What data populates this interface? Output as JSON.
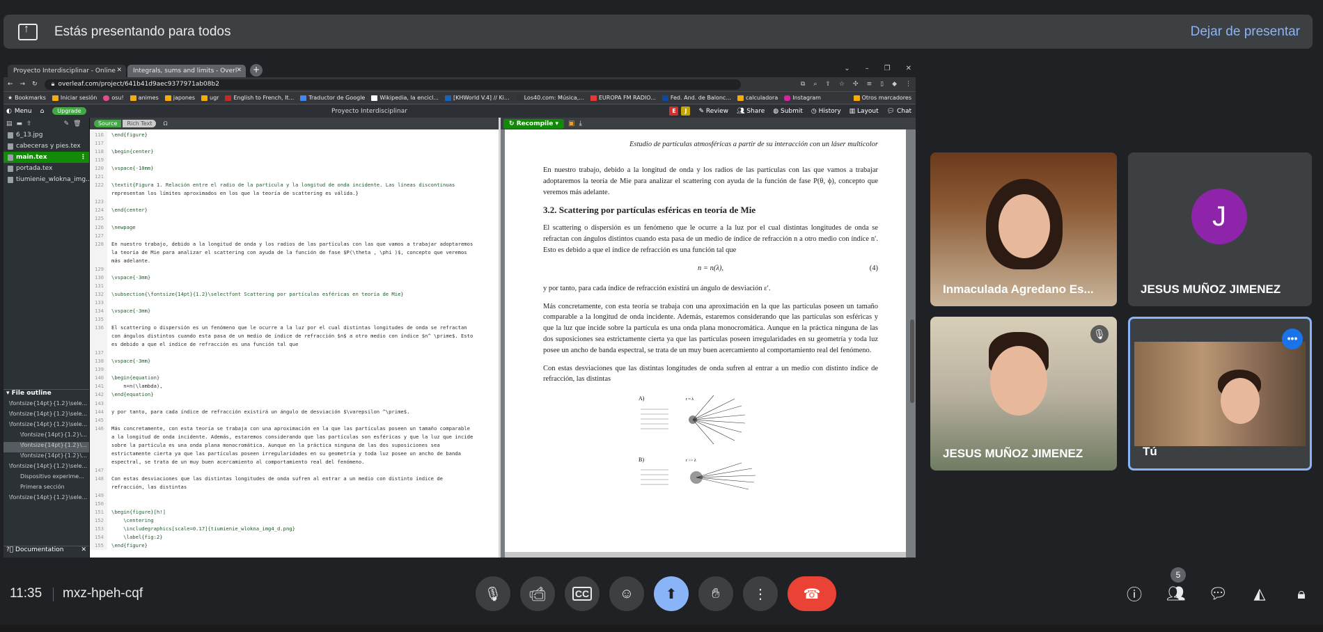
{
  "banner": {
    "title": "Estás presentando para todos",
    "stop_label": "Dejar de presentar"
  },
  "browser": {
    "tabs": [
      {
        "label": "Proyecto Interdisciplinar - Online"
      },
      {
        "label": "Integrals, sums and limits - Overl"
      }
    ],
    "url": "overleaf.com/project/641b41d9aec9377971ab08b2",
    "bookmarks": [
      "Bookmarks",
      "Iniciar sesión",
      "osu!",
      "animes",
      "japones",
      "ugr",
      "English to French, It...",
      "Traductor de Google",
      "Wikipedia, la encicl...",
      "[KHWorld V.4] // Ki...",
      "Los40.com: Música,...",
      "EUROPA FM RADIO...",
      "Fed. And. de Balonc...",
      "calculadora",
      "Instagram",
      "Otros marcadores"
    ]
  },
  "overleaf": {
    "menu_label": "Menu",
    "upgrade_label": "Upgrade",
    "project_title": "Proyecto Interdisciplinar",
    "collab_e": "E",
    "collab_j": "J",
    "toolbar": [
      "Review",
      "Share",
      "Submit",
      "History",
      "Layout",
      "Chat"
    ],
    "source_label": "Source",
    "richtext_label": "Rich Text",
    "recompile_label": "Recompile",
    "files": [
      "6_13.jpg",
      "cabeceras y pies.tex",
      "main.tex",
      "portada.tex",
      "tiumienie_wlokna_img..."
    ],
    "outline_title": "File outline",
    "outline": [
      "\\fontsize{14pt}{1.2}\\sele...",
      "\\fontsize{14pt}{1.2}\\sele...",
      "\\fontsize{14pt}{1.2}\\sele...",
      "\\fontsize{14pt}{1.2}\\...",
      "\\fontsize{14pt}{1.2}\\...",
      "\\fontsize{14pt}{1.2}\\...",
      "\\fontsize{14pt}{1.2}\\sele...",
      "Dispositivo experime...",
      "Primera sección",
      "\\fontsize{14pt}{1.2}\\sele..."
    ],
    "documentation_label": "Documentation",
    "code_lines": [
      {
        "n": "116",
        "t": "\\end{figure}"
      },
      {
        "n": "117",
        "t": ""
      },
      {
        "n": "118",
        "t": "\\begin{center}"
      },
      {
        "n": "119",
        "t": ""
      },
      {
        "n": "120",
        "t": "\\vspace{-10mm}"
      },
      {
        "n": "121",
        "t": ""
      },
      {
        "n": "122",
        "t": "\\textit{Figura 1. Relación entre el radio de la partícula y la longitud de onda incidente. Las líneas discontinuas"
      },
      {
        "n": "",
        "t": "representan los límites aproximados en los que la teoría de scattering es válida.}"
      },
      {
        "n": "123",
        "t": ""
      },
      {
        "n": "124",
        "t": "\\end{center}"
      },
      {
        "n": "125",
        "t": ""
      },
      {
        "n": "126",
        "t": "\\newpage"
      },
      {
        "n": "127",
        "t": ""
      },
      {
        "n": "128",
        "t": "En nuestro trabajo, debido a la longitud de onda y los radios de las partículas con las que vamos a trabajar adoptaremos"
      },
      {
        "n": "",
        "t": "la teoría de Mie para analizar el scattering con ayuda de la función de fase $P(\\theta , \\phi )$, concepto que veremos"
      },
      {
        "n": "",
        "t": "más adelante."
      },
      {
        "n": "129",
        "t": ""
      },
      {
        "n": "130",
        "t": "\\vspace{-3mm}"
      },
      {
        "n": "131",
        "t": ""
      },
      {
        "n": "132",
        "t": "\\subsection{\\fontsize{14pt}{1.2}\\selectfont Scattering por partículas esféricas en teoría de Mie}"
      },
      {
        "n": "133",
        "t": ""
      },
      {
        "n": "134",
        "t": "\\vspace{-3mm}"
      },
      {
        "n": "135",
        "t": ""
      },
      {
        "n": "136",
        "t": "El scattering o dispersión es un fenómeno que le ocurre a la luz por el cual distintas longitudes de onda se refractan"
      },
      {
        "n": "",
        "t": "con ángulos distintos cuando esta pasa de un medio de índice de refracción $n$ a otro medio con índice $n^ \\prime$. Esto"
      },
      {
        "n": "",
        "t": "es debido a que el índice de refracción es una función tal que"
      },
      {
        "n": "137",
        "t": ""
      },
      {
        "n": "138",
        "t": "\\vspace{-3mm}"
      },
      {
        "n": "139",
        "t": ""
      },
      {
        "n": "140",
        "t": "\\begin{equation}"
      },
      {
        "n": "141",
        "t": "    n=n(\\lambda),"
      },
      {
        "n": "142",
        "t": "\\end{equation}"
      },
      {
        "n": "143",
        "t": ""
      },
      {
        "n": "144",
        "t": "y por tanto, para cada índice de refracción existirá un ángulo de desviación $\\varepsilon ^\\prime$."
      },
      {
        "n": "145",
        "t": ""
      },
      {
        "n": "146",
        "t": "Más concretamente, con esta teoría se trabaja con una aproximación en la que las partículas poseen un tamaño comparable"
      },
      {
        "n": "",
        "t": "a la longitud de onda incidente. Además, estaremos considerando que las partículas son esféricas y que la luz que incide"
      },
      {
        "n": "",
        "t": "sobre la partícula es una onda plana monocromática. Aunque en la práctica ninguna de las dos suposiciones sea"
      },
      {
        "n": "",
        "t": "estrictamente cierta ya que las partículas poseen irregularidades en su geometría y toda luz posee un ancho de banda"
      },
      {
        "n": "",
        "t": "espectral, se trata de un muy buen acercamiento al comportamiento real del fenómeno."
      },
      {
        "n": "147",
        "t": ""
      },
      {
        "n": "148",
        "t": "Con estas desviaciones que las distintas longitudes de onda sufren al entrar a un medio con distinto índice de"
      },
      {
        "n": "",
        "t": "refracción, las distintas"
      },
      {
        "n": "149",
        "t": ""
      },
      {
        "n": "150",
        "t": ""
      },
      {
        "n": "151",
        "t": "\\begin{figure}[h!]"
      },
      {
        "n": "152",
        "t": "    \\centering"
      },
      {
        "n": "153",
        "t": "    \\includegraphics[scale=0.17]{tiumienie_wlokna_img4_d.png}"
      },
      {
        "n": "154",
        "t": "    \\label{fig:2}"
      },
      {
        "n": "155",
        "t": "\\end{figure}"
      }
    ],
    "pdf": {
      "header": "Estudio de partículas atmosféricas a partir de su interacción con un láser multicolor",
      "p1": "En nuestro trabajo, debido a la longitud de onda y los radios de las partículas con las que vamos a trabajar adoptaremos la teoría de Mie para analizar el scattering con ayuda de la función de fase P(θ, ϕ), concepto que veremos más adelante.",
      "section": "3.2.   Scattering por partículas esféricas en teoría de Mie",
      "p2": "El scattering o dispersión es un fenómeno que le ocurre a la luz por el cual distintas longitudes de onda se refractan con ángulos distintos cuando esta pasa de un medio de índice de refracción n a otro medio con índice n′. Esto es debido a que el índice de refracción es una función tal que",
      "equation": "n = n(λ),",
      "eq_number": "(4)",
      "p3": "y por tanto, para cada índice de refracción existirá un ángulo de desviación ε′.",
      "p4": "Más concretamente, con esta teoría se trabaja con una aproximación en la que las partículas poseen un tamaño comparable a la longitud de onda incidente. Además, estaremos considerando que las partículas son esféricas y que la luz que incide sobre la partícula es una onda plana monocromática. Aunque en la práctica ninguna de las dos suposiciones sea estrictamente cierta ya que las partículas poseen irregularidades en su geometría y toda luz posee un ancho de banda espectral, se trata de un muy buen acercamiento al comportamiento real del fenómeno.",
      "p5": "Con estas desviaciones que las distintas longitudes de onda sufren al entrar a un medio con distinto índice de refracción, las distintas",
      "fig_a": "A)",
      "fig_b": "B)",
      "fig_a_cond": "r ≈ λ",
      "fig_b_cond": "r >> λ"
    }
  },
  "participants": [
    {
      "name": "Inmaculada Agredano Es..."
    },
    {
      "name": "JESUS MUÑOZ JIMENEZ",
      "initial": "J"
    },
    {
      "name": "JESUS MUÑOZ JIMENEZ"
    },
    {
      "name": "Tú"
    }
  ],
  "bottom": {
    "time": "11:35",
    "meeting_code": "mxz-hpeh-cqf",
    "people_count": "5"
  }
}
